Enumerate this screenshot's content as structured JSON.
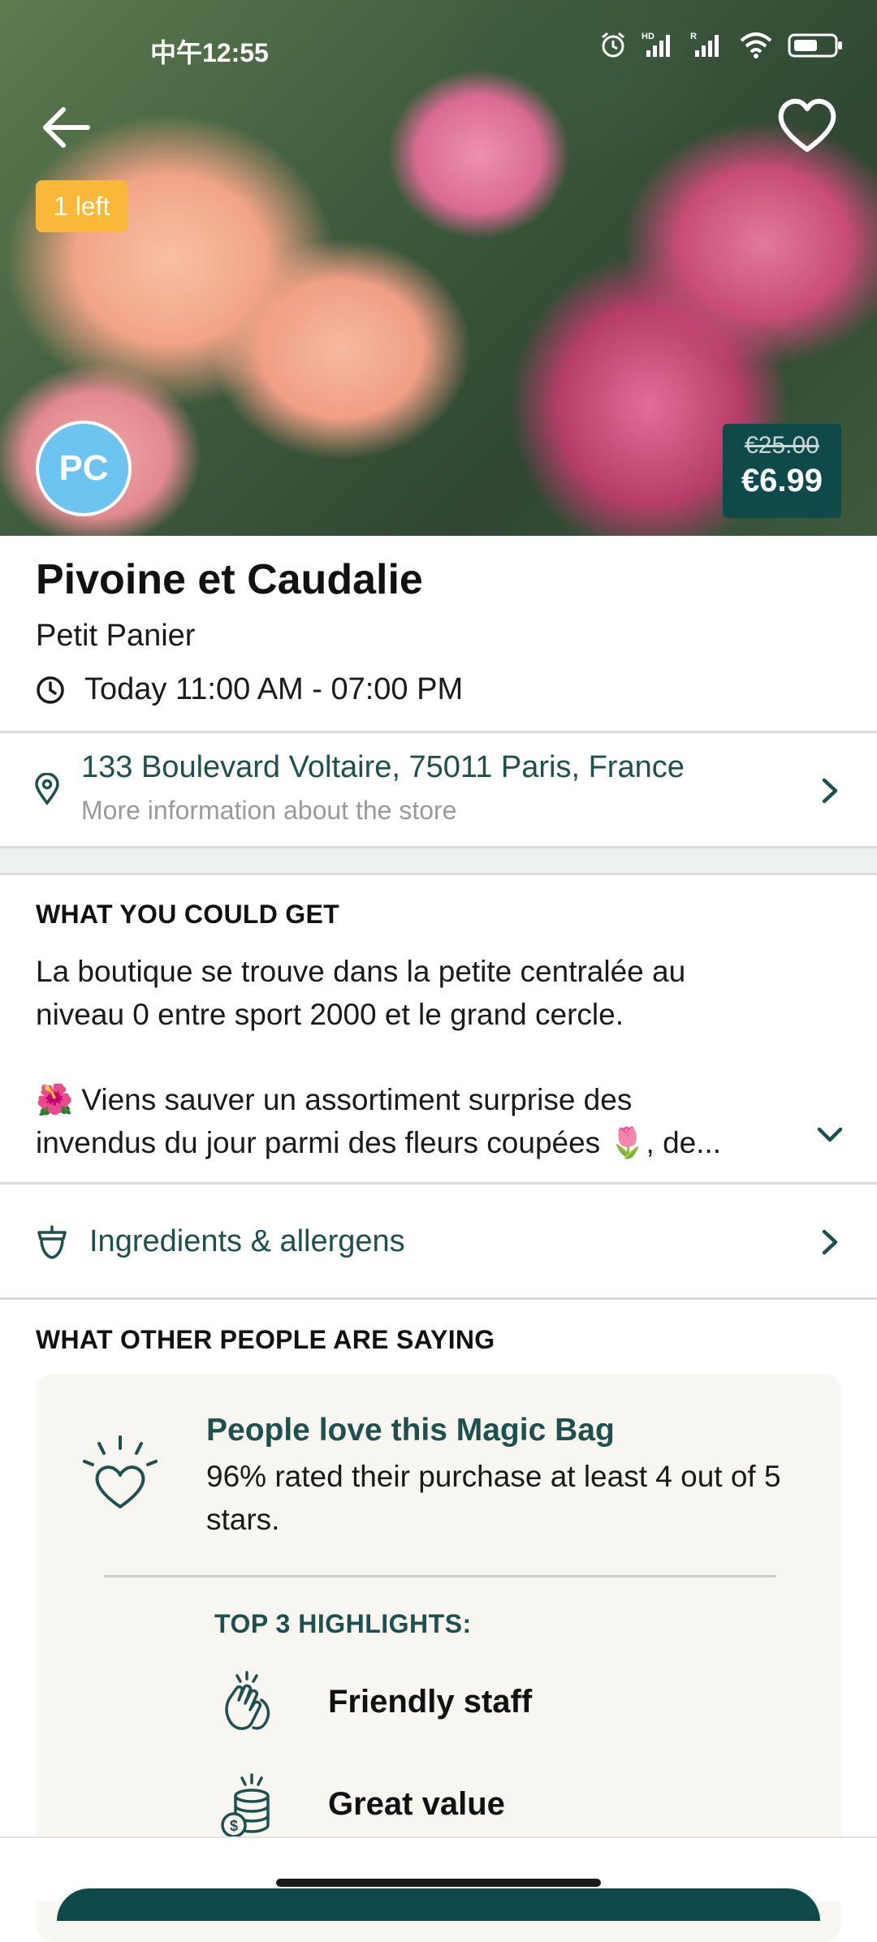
{
  "status_bar": {
    "time": "中午12:55",
    "icons": [
      "alarm-icon",
      "signal-hd-icon",
      "signal-r-icon",
      "wifi-icon",
      "battery-icon"
    ]
  },
  "hero": {
    "items_left": "1 left",
    "store_initials": "PC",
    "price_original": "€25.00",
    "price_current": "€6.99"
  },
  "store": {
    "name": "Pivoine et Caudalie",
    "bag_type": "Petit Panier",
    "pickup_time": "Today 11:00 AM - 07:00 PM",
    "address": "133 Boulevard Voltaire, 75011 Paris, France",
    "address_sub": "More information about the store"
  },
  "what_you_get": {
    "heading": "WHAT YOU COULD GET",
    "paragraph1_line1": "La boutique se trouve dans la petite centralée au",
    "paragraph1_line2": "niveau 0 entre sport 2000 et le grand cercle.",
    "paragraph2_line1": "🌺 Viens sauver un assortiment surprise des",
    "paragraph2_line2": "invendus du jour parmi des fleurs coupées 🌷, de..."
  },
  "ingredients": {
    "label": "Ingredients & allergens"
  },
  "reviews": {
    "heading": "WHAT OTHER PEOPLE ARE SAYING",
    "love_title": "People love this Magic Bag",
    "love_text": "96% rated their purchase at least 4 out of 5 stars.",
    "highlights_title": "TOP 3 HIGHLIGHTS:",
    "highlights": [
      {
        "label": "Friendly staff",
        "icon": "clapping-hands-icon"
      },
      {
        "label": "Great value",
        "icon": "coins-icon"
      }
    ]
  },
  "colors": {
    "accent": "#1e5050",
    "badge": "#f9b838",
    "price_bg": "#0f4a4a",
    "avatar": "#6cc4f0"
  }
}
